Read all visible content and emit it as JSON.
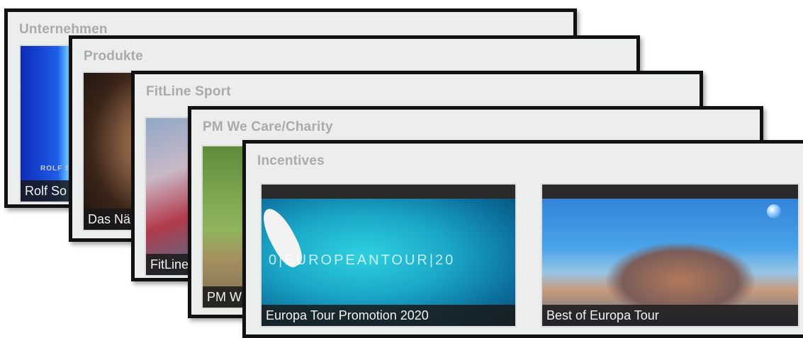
{
  "cards": [
    {
      "title": "Unternehmen",
      "videos": [
        {
          "caption": "Rolf So",
          "overlay": "ROLF S"
        }
      ]
    },
    {
      "title": "Produkte",
      "videos": [
        {
          "caption": "Das Nä"
        }
      ]
    },
    {
      "title": "FitLine Sport",
      "videos": [
        {
          "caption": "FitLine"
        }
      ]
    },
    {
      "title": "PM We Care/Charity",
      "videos": [
        {
          "caption": "PM WE"
        }
      ]
    },
    {
      "title": "Incentives",
      "videos": [
        {
          "caption": "Europa Tour Promotion 2020",
          "overlay": "0|EUROPEANTOUR|20"
        },
        {
          "caption": "Best of Europa Tour"
        }
      ]
    }
  ]
}
